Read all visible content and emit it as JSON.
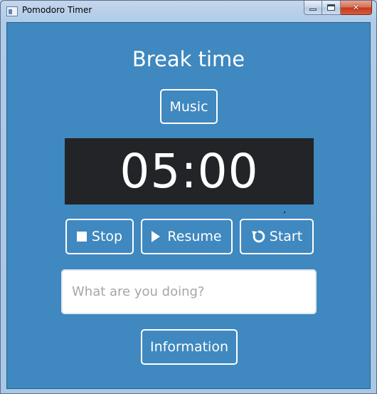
{
  "window": {
    "title": "Pomodoro Timer",
    "controls": {
      "minimize": "",
      "maximize": "",
      "close": "✕"
    }
  },
  "app": {
    "heading": "Break time",
    "music_label": "Music",
    "timer": "05:00",
    "buttons": {
      "stop": {
        "label": "Stop",
        "icon": "stop-icon"
      },
      "resume": {
        "label": "Resume",
        "icon": "play-icon"
      },
      "start": {
        "label": "Start",
        "icon": "restart-icon"
      }
    },
    "task_input": {
      "placeholder": "What are you doing?",
      "value": ""
    },
    "info_label": "Information"
  },
  "colors": {
    "background": "#3f88c0",
    "timer_bg": "#222428",
    "text": "#ffffff"
  }
}
